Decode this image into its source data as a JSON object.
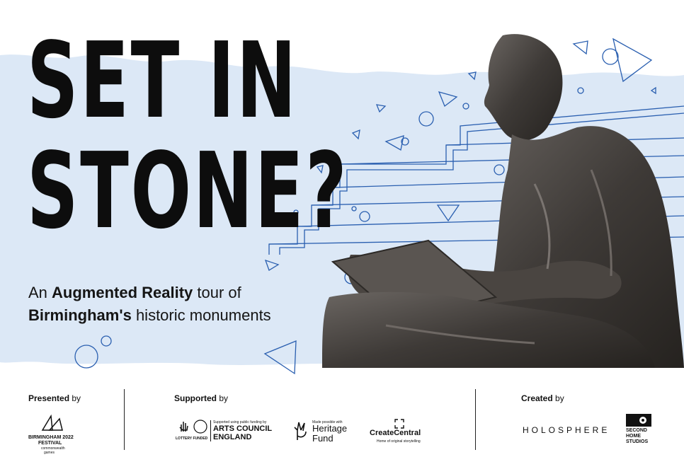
{
  "title": {
    "line1": "SET IN",
    "line2": "STONE?"
  },
  "subtitle": {
    "line1_prefix": "An ",
    "line1_bold": "Augmented Reality",
    "line1_suffix": " tour of",
    "line2_bold": "Birmingham's",
    "line2_suffix": " historic monuments"
  },
  "footer": {
    "presented_bold": "Presented",
    "presented_rest": " by",
    "supported_bold": "Supported",
    "supported_rest": " by",
    "created_bold": "Created",
    "created_rest": " by",
    "logos": {
      "birmingham": {
        "line1": "BIRMINGHAM 2022",
        "line2": "FESTIVAL",
        "line3": "commonwealth",
        "line4": "games"
      },
      "arts_council": {
        "small": "Supported using public funding by",
        "line1": "ARTS COUNCIL",
        "line2": "ENGLAND",
        "lottery": "LOTTERY FUNDED"
      },
      "heritage": {
        "small": "Made possible with",
        "line1": "Heritage",
        "line2": "Fund"
      },
      "create_central": {
        "name": "CreateCentral",
        "tagline": "Home of original storytelling"
      },
      "holosphere": "HOLOSPHERE",
      "second_home": {
        "line1": "SECOND",
        "line2": "HOME",
        "line3": "STUDIOS"
      }
    }
  },
  "colors": {
    "band": "#dce8f6",
    "line_art": "#2a5fb0",
    "text": "#111111"
  }
}
